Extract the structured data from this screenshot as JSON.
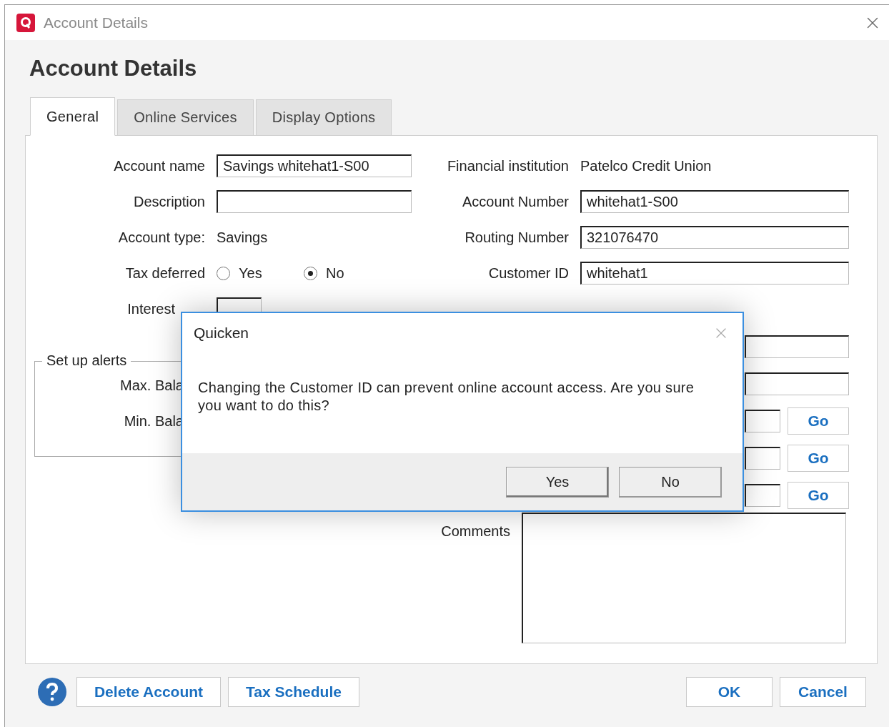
{
  "window": {
    "title": "Account Details"
  },
  "heading": "Account Details",
  "tabs": [
    {
      "label": "General",
      "selected": true
    },
    {
      "label": "Online Services",
      "selected": false
    },
    {
      "label": "Display Options",
      "selected": false
    }
  ],
  "left_fields": [
    {
      "kind": "input",
      "label": "Account name",
      "value": "Savings whitehat1-S00"
    },
    {
      "kind": "input",
      "label": "Description"
    },
    {
      "kind": "text",
      "label": "Account type:",
      "value": "Savings"
    },
    {
      "kind": "radio",
      "label": "Tax deferred",
      "options": [
        {
          "label": "Yes",
          "selected": false
        },
        {
          "label": "No",
          "selected": true
        }
      ]
    },
    {
      "kind": "small",
      "label": "Interest"
    }
  ],
  "right_fields": [
    {
      "kind": "text",
      "label": "Financial institution",
      "value": "Patelco Credit Union"
    },
    {
      "kind": "input",
      "label": "Account Number",
      "value": "whitehat1-S00"
    },
    {
      "kind": "input",
      "label": "Routing Number",
      "value": "321076470"
    },
    {
      "kind": "input",
      "label": "Customer ID",
      "value": "whitehat1"
    }
  ],
  "alerts": {
    "title": "Set up alerts",
    "labels": [
      "Max. Bala",
      "Min. Bala"
    ]
  },
  "lower_rows": [
    {
      "kind": "field"
    },
    {
      "kind": "field"
    },
    {
      "kind": "go",
      "button": "Go"
    },
    {
      "kind": "go",
      "button": "Go"
    },
    {
      "kind": "go",
      "button": "Go"
    }
  ],
  "comments": {
    "label": "Comments"
  },
  "footer": {
    "left_buttons": [
      "Delete Account",
      "Tax Schedule"
    ],
    "right_buttons": [
      "OK",
      "Cancel"
    ]
  },
  "dialog": {
    "title": "Quicken",
    "message": "Changing the Customer ID can prevent online account access. Are you sure you want to do this?",
    "buttons": [
      {
        "label": "Yes",
        "default": true
      },
      {
        "label": "No",
        "default": false
      }
    ]
  }
}
